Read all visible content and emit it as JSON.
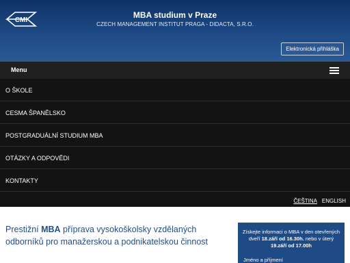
{
  "header": {
    "title": "MBA studium v Praze",
    "subtitle": "CZECH MANAGEMENT INSTITUT PRAGA - DIDACTA, S.R.O.",
    "login_label": "Elektronická přihláška"
  },
  "menu": {
    "label": "Menu",
    "items": [
      {
        "label": "O ŠKOLE"
      },
      {
        "label": "CESMA ŠPANĚLSKO"
      },
      {
        "label": "POSTGRADUÁLNÍ STUDIUM MBA"
      },
      {
        "label": "OTÁZKY A ODPOVĚDI"
      },
      {
        "label": "KONTAKTY"
      }
    ]
  },
  "languages": {
    "cs": "ČEŠTINA",
    "en": "ENGLISH"
  },
  "intro": {
    "part1": "Prestižní ",
    "bold": "MBA",
    "part2": " příprava vysokoškolsky vzdělaných odborníků pro manažerskou a podnikatelskou činnost"
  },
  "info": {
    "line1": "Získejte informaci o MBA v den otevřených dveří ",
    "date1": "18.září od 16.30h.",
    "line2": " nebo v úterý ",
    "date2": "19.září od 17.00h",
    "name_label": "Jméno a příjmení"
  },
  "colors": {
    "header_bg": "#1e4a86",
    "nav_bg": "#131313",
    "accent_text": "#244e83"
  }
}
